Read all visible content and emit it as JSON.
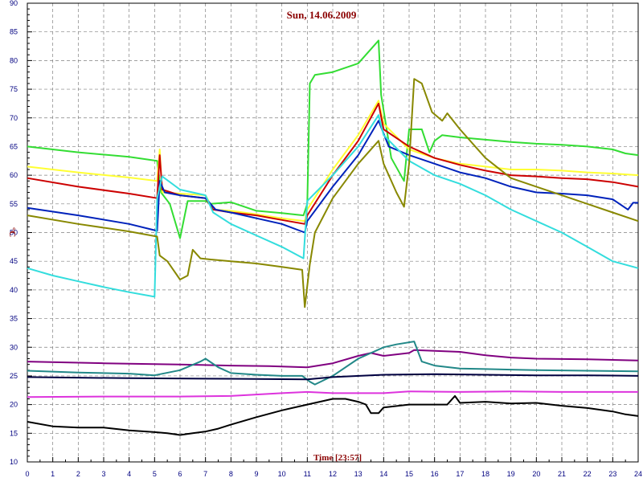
{
  "chart_data": {
    "type": "line",
    "title": "Sun, 14.06.2009",
    "xlabel": "Time [23:57]",
    "ylabel": "°C",
    "xlim": [
      0,
      24
    ],
    "ylim": [
      10,
      90
    ],
    "x_ticks": [
      0,
      1,
      2,
      3,
      4,
      5,
      6,
      7,
      8,
      9,
      10,
      11,
      12,
      13,
      14,
      15,
      16,
      17,
      18,
      19,
      20,
      21,
      22,
      23,
      24
    ],
    "y_ticks": [
      10,
      15,
      20,
      25,
      30,
      35,
      40,
      45,
      50,
      55,
      60,
      65,
      70,
      75,
      80,
      85,
      90
    ],
    "grid": true,
    "colors": {
      "title": "#8B0000",
      "ylabel": "#8B0000",
      "xlabel": "#8B0000",
      "ticks": "#000080",
      "grid": "#808080",
      "frame": "#000000"
    },
    "series": [
      {
        "color": "#33DD33",
        "points": [
          [
            0,
            65
          ],
          [
            2,
            64
          ],
          [
            4,
            63.2
          ],
          [
            5.1,
            62.5
          ],
          [
            5.25,
            57
          ],
          [
            5.6,
            55
          ],
          [
            6,
            49
          ],
          [
            6.3,
            55.5
          ],
          [
            7,
            55.5
          ],
          [
            7.2,
            55
          ],
          [
            8,
            55.3
          ],
          [
            9,
            53.8
          ],
          [
            10,
            53.4
          ],
          [
            10.85,
            53
          ],
          [
            11,
            55
          ],
          [
            11.1,
            76
          ],
          [
            11.3,
            77.5
          ],
          [
            12,
            78
          ],
          [
            13,
            79.5
          ],
          [
            13.8,
            83.5
          ],
          [
            13.9,
            74
          ],
          [
            14.3,
            63
          ],
          [
            14.8,
            59
          ],
          [
            15,
            68
          ],
          [
            15.5,
            68
          ],
          [
            15.8,
            64
          ],
          [
            16,
            66
          ],
          [
            16.3,
            67
          ],
          [
            17,
            66.6
          ],
          [
            18,
            66.2
          ],
          [
            19,
            65.8
          ],
          [
            20,
            65.5
          ],
          [
            21,
            65.3
          ],
          [
            22,
            65
          ],
          [
            23,
            64.5
          ],
          [
            23.5,
            63.8
          ],
          [
            24,
            63.5
          ]
        ]
      },
      {
        "color": "#FFFF33",
        "points": [
          [
            0,
            61.5
          ],
          [
            2,
            60.5
          ],
          [
            4,
            59.6
          ],
          [
            5.1,
            59
          ],
          [
            5.2,
            64.5
          ],
          [
            5.3,
            57
          ],
          [
            6,
            56.8
          ],
          [
            7,
            56.5
          ],
          [
            7.3,
            54
          ],
          [
            8,
            53.8
          ],
          [
            9,
            53.2
          ],
          [
            10,
            52.5
          ],
          [
            10.9,
            52
          ],
          [
            11,
            54
          ],
          [
            12,
            61
          ],
          [
            13,
            67
          ],
          [
            13.8,
            73
          ],
          [
            14,
            69
          ],
          [
            15,
            64.5
          ],
          [
            16,
            63
          ],
          [
            17,
            62
          ],
          [
            18,
            61.5
          ],
          [
            19,
            61
          ],
          [
            20,
            61
          ],
          [
            21,
            60.8
          ],
          [
            22,
            60.5
          ],
          [
            23,
            60.3
          ],
          [
            24,
            60
          ]
        ]
      },
      {
        "color": "#CC0000",
        "points": [
          [
            0,
            59.5
          ],
          [
            2,
            58
          ],
          [
            4,
            56.8
          ],
          [
            5.1,
            56
          ],
          [
            5.2,
            63.5
          ],
          [
            5.3,
            57.5
          ],
          [
            6,
            56.5
          ],
          [
            7,
            56
          ],
          [
            7.3,
            54
          ],
          [
            8,
            53.5
          ],
          [
            9,
            53
          ],
          [
            10,
            52.2
          ],
          [
            10.9,
            51.5
          ],
          [
            11,
            53
          ],
          [
            12,
            60
          ],
          [
            13,
            66
          ],
          [
            13.8,
            72.5
          ],
          [
            14,
            68
          ],
          [
            15,
            65
          ],
          [
            16,
            63
          ],
          [
            17,
            61.8
          ],
          [
            18,
            60.8
          ],
          [
            19,
            60
          ],
          [
            20,
            59.8
          ],
          [
            21,
            59.5
          ],
          [
            22,
            59.3
          ],
          [
            23,
            58.8
          ],
          [
            24,
            58
          ]
        ]
      },
      {
        "color": "#0022BB",
        "points": [
          [
            0,
            54.3
          ],
          [
            2,
            53
          ],
          [
            4,
            51.5
          ],
          [
            5.1,
            50.3
          ],
          [
            5.2,
            59
          ],
          [
            5.4,
            57
          ],
          [
            6,
            56.5
          ],
          [
            7,
            56
          ],
          [
            7.4,
            54
          ],
          [
            8,
            53.5
          ],
          [
            9,
            52.5
          ],
          [
            10,
            51.5
          ],
          [
            10.9,
            50
          ],
          [
            11,
            52
          ],
          [
            12,
            58
          ],
          [
            13,
            63.5
          ],
          [
            13.8,
            69.5
          ],
          [
            14.2,
            65
          ],
          [
            15,
            63.5
          ],
          [
            16,
            62
          ],
          [
            17,
            60.5
          ],
          [
            18,
            59.5
          ],
          [
            19,
            58
          ],
          [
            20,
            57
          ],
          [
            21,
            56.8
          ],
          [
            22,
            56.5
          ],
          [
            23,
            55.8
          ],
          [
            23.6,
            54
          ],
          [
            23.8,
            55.2
          ],
          [
            24,
            55.2
          ]
        ]
      },
      {
        "color": "#33DDDD",
        "points": [
          [
            0,
            43.8
          ],
          [
            1,
            42.5
          ],
          [
            2,
            41.5
          ],
          [
            3,
            40.5
          ],
          [
            4,
            39.6
          ],
          [
            5,
            38.8
          ],
          [
            5.1,
            56
          ],
          [
            5.3,
            59.8
          ],
          [
            6,
            57.5
          ],
          [
            7,
            56.5
          ],
          [
            7.3,
            53.5
          ],
          [
            8,
            51.5
          ],
          [
            9,
            49.5
          ],
          [
            10,
            47.5
          ],
          [
            10.85,
            45.5
          ],
          [
            11,
            55.5
          ],
          [
            12,
            60
          ],
          [
            13,
            65
          ],
          [
            13.8,
            70.5
          ],
          [
            14,
            67
          ],
          [
            15,
            62.5
          ],
          [
            16,
            60
          ],
          [
            17,
            58.5
          ],
          [
            18,
            56.5
          ],
          [
            19,
            54
          ],
          [
            20,
            52
          ],
          [
            21,
            50
          ],
          [
            22,
            47.5
          ],
          [
            23,
            45
          ],
          [
            24,
            43.8
          ]
        ]
      },
      {
        "color": "#888800",
        "points": [
          [
            0,
            53
          ],
          [
            2,
            51.5
          ],
          [
            4,
            50.2
          ],
          [
            5.1,
            49.3
          ],
          [
            5.2,
            46
          ],
          [
            5.5,
            45
          ],
          [
            6,
            41.8
          ],
          [
            6.3,
            42.5
          ],
          [
            6.5,
            47
          ],
          [
            6.8,
            45.5
          ],
          [
            7.2,
            45.3
          ],
          [
            8,
            45
          ],
          [
            9,
            44.6
          ],
          [
            10,
            44
          ],
          [
            10.8,
            43.5
          ],
          [
            10.9,
            37
          ],
          [
            11.1,
            44.5
          ],
          [
            11.3,
            50
          ],
          [
            12,
            56
          ],
          [
            13,
            62
          ],
          [
            13.8,
            66
          ],
          [
            14,
            62
          ],
          [
            14.5,
            57
          ],
          [
            14.8,
            54.5
          ],
          [
            15,
            62
          ],
          [
            15.2,
            76.8
          ],
          [
            15.5,
            76
          ],
          [
            15.9,
            71
          ],
          [
            16.3,
            69.5
          ],
          [
            16.5,
            70.8
          ],
          [
            17,
            68
          ],
          [
            18,
            63
          ],
          [
            19,
            59.5
          ],
          [
            20,
            58
          ],
          [
            21,
            56.5
          ],
          [
            22,
            55
          ],
          [
            23,
            53.5
          ],
          [
            24,
            52
          ]
        ]
      },
      {
        "color": "#800080",
        "points": [
          [
            0,
            27.5
          ],
          [
            3,
            27.2
          ],
          [
            6,
            27
          ],
          [
            8,
            26.8
          ],
          [
            9.5,
            26.7
          ],
          [
            11,
            26.5
          ],
          [
            12,
            27.2
          ],
          [
            13,
            28.5
          ],
          [
            13.5,
            29
          ],
          [
            14,
            28.5
          ],
          [
            15,
            29
          ],
          [
            15.2,
            29.5
          ],
          [
            17,
            29.2
          ],
          [
            18,
            28.6
          ],
          [
            19,
            28.2
          ],
          [
            20,
            28
          ],
          [
            22,
            27.9
          ],
          [
            24,
            27.7
          ]
        ]
      },
      {
        "color": "#228888",
        "points": [
          [
            0,
            25.9
          ],
          [
            2,
            25.6
          ],
          [
            4,
            25.4
          ],
          [
            5,
            25.1
          ],
          [
            6,
            26
          ],
          [
            6.8,
            27.5
          ],
          [
            7,
            28
          ],
          [
            7.5,
            26.5
          ],
          [
            8,
            25.5
          ],
          [
            9,
            25.2
          ],
          [
            10,
            25
          ],
          [
            10.8,
            25
          ],
          [
            11.1,
            24
          ],
          [
            11.3,
            23.5
          ],
          [
            12,
            25
          ],
          [
            13,
            28
          ],
          [
            14,
            30
          ],
          [
            14.5,
            30.5
          ],
          [
            15.2,
            31
          ],
          [
            15.5,
            27.5
          ],
          [
            16,
            26.8
          ],
          [
            17,
            26.3
          ],
          [
            18,
            26.2
          ],
          [
            19,
            26.1
          ],
          [
            20,
            26
          ],
          [
            22,
            25.9
          ],
          [
            24,
            25.8
          ]
        ]
      },
      {
        "color": "#000040",
        "points": [
          [
            0,
            24.8
          ],
          [
            4,
            24.6
          ],
          [
            8,
            24.5
          ],
          [
            11,
            24.4
          ],
          [
            12,
            24.8
          ],
          [
            14,
            25.2
          ],
          [
            16,
            25.3
          ],
          [
            18,
            25.2
          ],
          [
            20,
            25.1
          ],
          [
            22,
            25.1
          ],
          [
            24,
            25
          ]
        ]
      },
      {
        "color": "#DD33DD",
        "points": [
          [
            0,
            21.3
          ],
          [
            3,
            21.4
          ],
          [
            6,
            21.4
          ],
          [
            8,
            21.5
          ],
          [
            10,
            22
          ],
          [
            11,
            22.2
          ],
          [
            12,
            22
          ],
          [
            14,
            22
          ],
          [
            15,
            22.3
          ],
          [
            17,
            22.2
          ],
          [
            19,
            22.3
          ],
          [
            21,
            22.2
          ],
          [
            24,
            22.2
          ]
        ]
      },
      {
        "color": "#000000",
        "points": [
          [
            0,
            17
          ],
          [
            1,
            16.2
          ],
          [
            2,
            16
          ],
          [
            3,
            16
          ],
          [
            4,
            15.5
          ],
          [
            5,
            15.2
          ],
          [
            5.5,
            15
          ],
          [
            6,
            14.7
          ],
          [
            6.5,
            15
          ],
          [
            7,
            15.3
          ],
          [
            7.5,
            15.8
          ],
          [
            8,
            16.5
          ],
          [
            9,
            17.8
          ],
          [
            10,
            19
          ],
          [
            11,
            20
          ],
          [
            12,
            21
          ],
          [
            12.5,
            21
          ],
          [
            13,
            20.5
          ],
          [
            13.3,
            20
          ],
          [
            13.5,
            18.5
          ],
          [
            13.8,
            18.5
          ],
          [
            14,
            19.5
          ],
          [
            15,
            20
          ],
          [
            16,
            20
          ],
          [
            16.5,
            20
          ],
          [
            16.8,
            21.5
          ],
          [
            17,
            20.3
          ],
          [
            18,
            20.5
          ],
          [
            19,
            20.2
          ],
          [
            20,
            20.3
          ],
          [
            21,
            19.8
          ],
          [
            22,
            19.4
          ],
          [
            23,
            18.8
          ],
          [
            23.5,
            18.3
          ],
          [
            24,
            18
          ]
        ]
      }
    ]
  }
}
